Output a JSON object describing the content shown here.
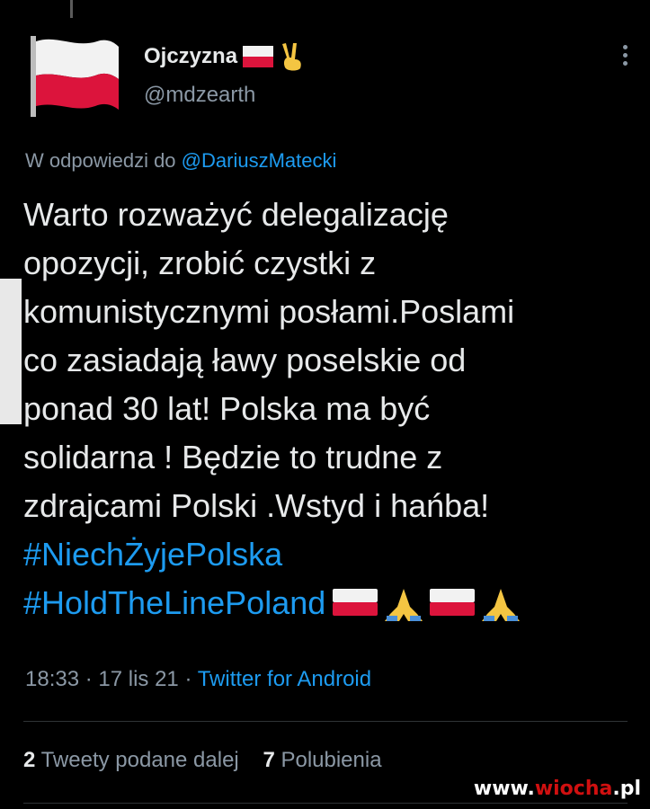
{
  "author": {
    "name": "Ojczyzna",
    "handle": "@mdzearth"
  },
  "reply": {
    "prefix": "W odpowiedzi do",
    "mention": "@DariuszMatecki"
  },
  "tweet": {
    "text": "Warto rozważyć delegalizację\nopozycji, zrobić czystki z\nkomunistycznymi posłami.Poslami\nco zasiadają ławy poselskie od\nponad 30 lat! Polska ma być\nsolidarna ! Będzie to trudne z\nzdrajcami Polski .Wstyd i hańba!",
    "hashtag1": "#NiechŻyjePolska",
    "hashtag2": "#HoldTheLinePoland"
  },
  "meta": {
    "time": "18:33",
    "sep1": " · ",
    "date": "17 lis 21",
    "sep2": " · ",
    "source": "Twitter for Android"
  },
  "stats": {
    "retweets_count": "2",
    "retweets_label": "Tweety podane dalej",
    "likes_count": "7",
    "likes_label": "Polubienia"
  },
  "watermark": {
    "prefix": "www.",
    "brand": "wiocha",
    "suffix": ".pl"
  },
  "icons": {
    "avatar": "polish-flag-icon",
    "name_emojis": [
      "polish-flag-icon",
      "victory-hand-icon"
    ],
    "end_emojis": [
      "polish-flag-icon",
      "praying-hands-icon",
      "polish-flag-icon",
      "praying-hands-icon"
    ],
    "menu": "more-vertical-icon"
  },
  "colors": {
    "background": "#000000",
    "text": "#e7e9ea",
    "muted": "#8b98a5",
    "accent": "#1d9bf0",
    "flag_red": "#dc143c"
  }
}
